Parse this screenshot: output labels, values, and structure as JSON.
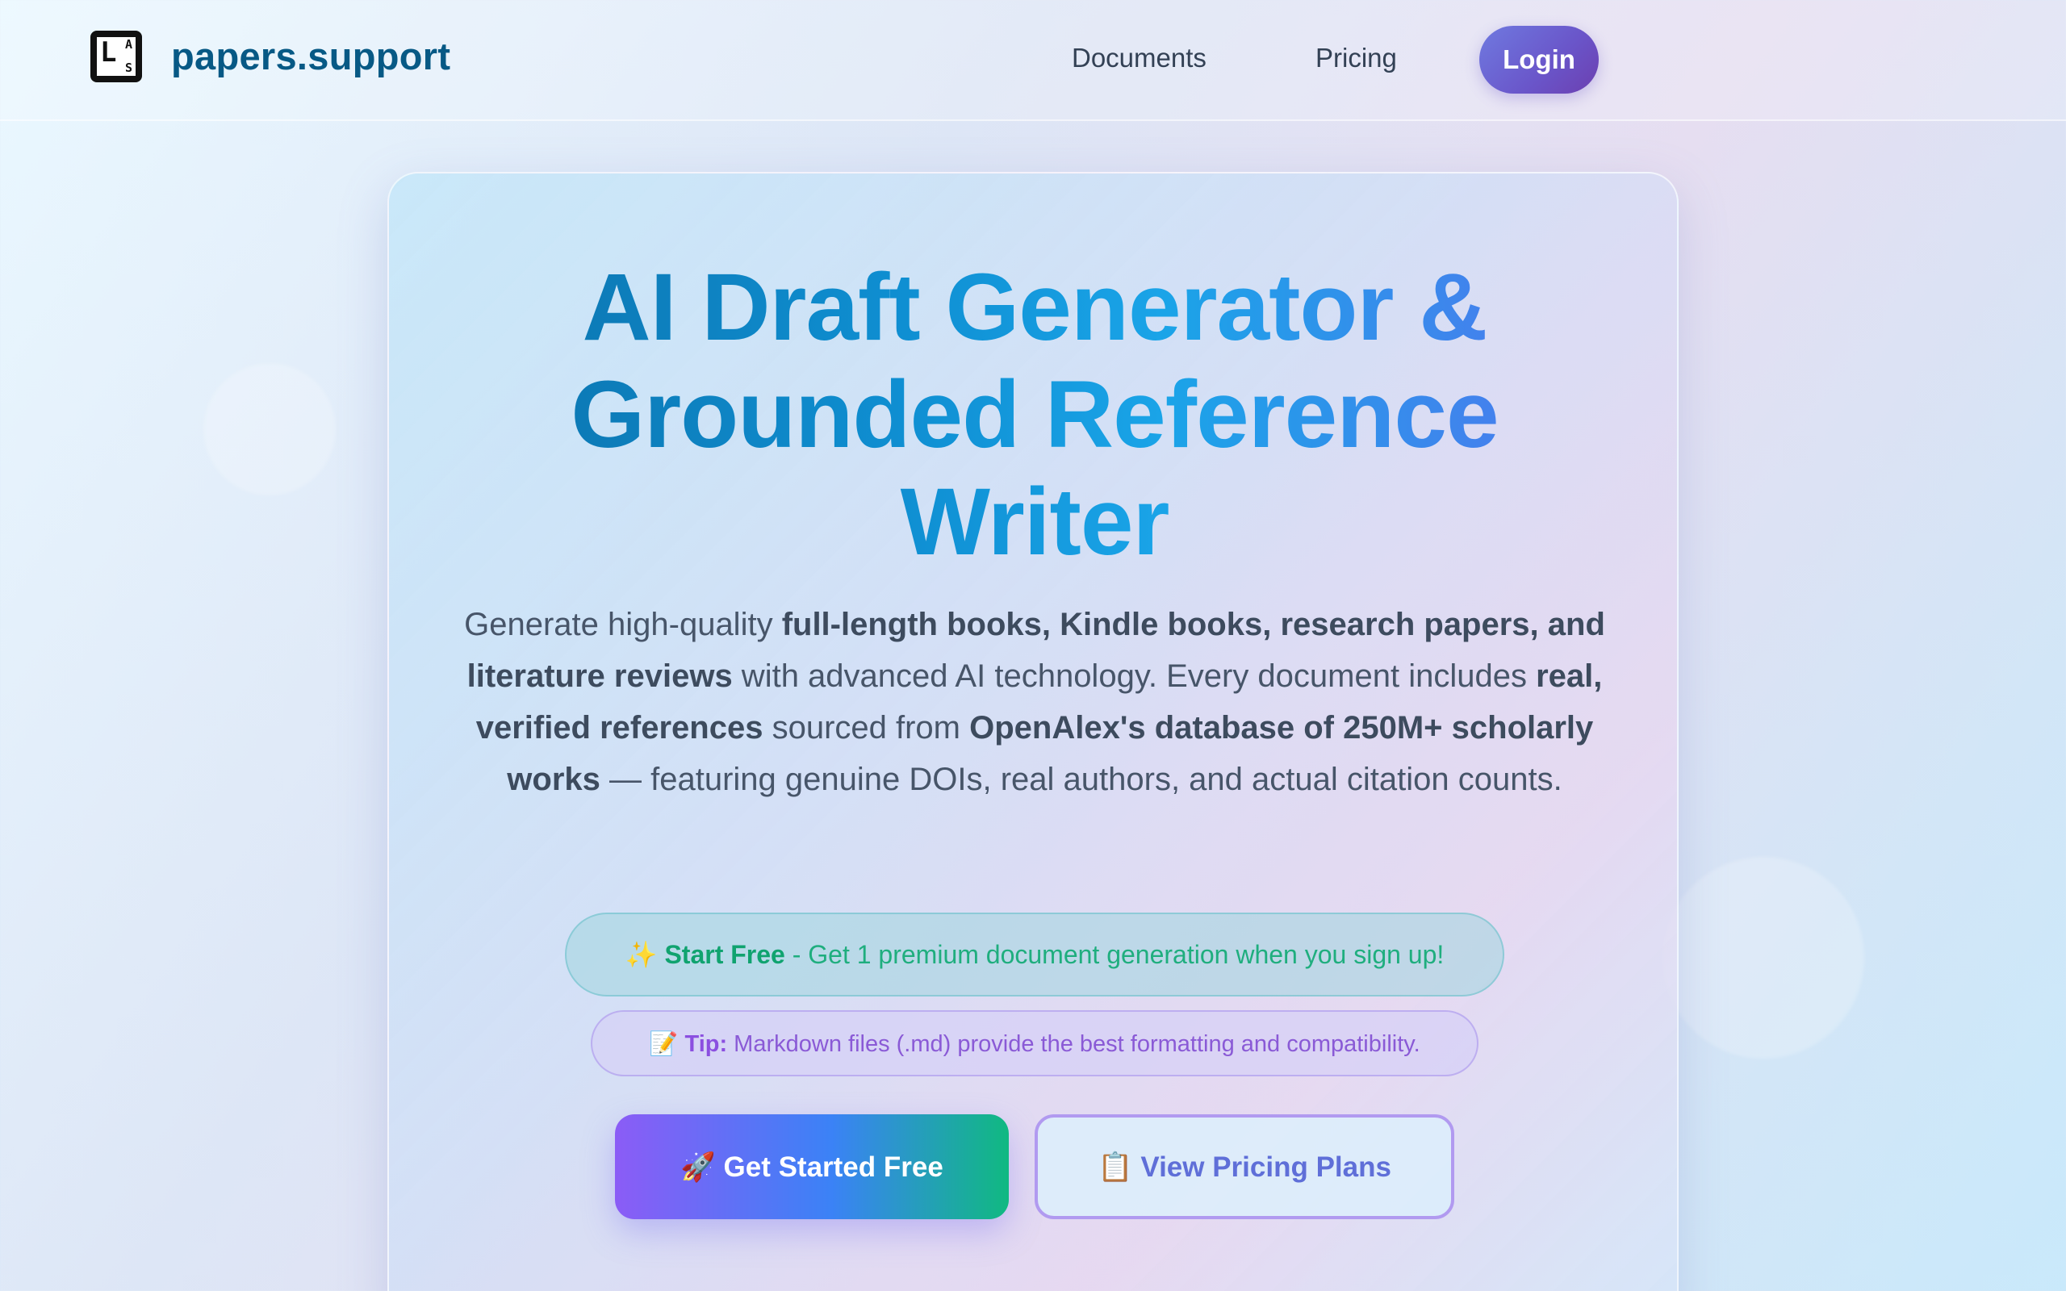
{
  "header": {
    "logo_letters": [
      "L",
      "A",
      "S"
    ],
    "brand": "papers.support",
    "nav": {
      "documents": "Documents",
      "pricing": "Pricing",
      "login": "Login"
    }
  },
  "hero": {
    "title_lines": [
      "AI Draft Generator &",
      "Grounded Reference",
      "Writer"
    ],
    "description": {
      "p1": "Generate high-quality ",
      "b1": "full-length books, Kindle books, research papers, and literature reviews",
      "p2": " with advanced AI technology. Every document includes ",
      "b2": "real, verified references",
      "p3": " sourced from ",
      "b3": "OpenAlex's database of 250M+ scholarly works",
      "p4": " — featuring genuine DOIs, real authors, and actual citation counts."
    },
    "promo": {
      "icon": "✨",
      "bold": "Start Free",
      "text": " - Get 1 premium document generation when you sign up!"
    },
    "tip": {
      "icon": "📝",
      "bold": "Tip:",
      "text": " Markdown files (.md) provide the best formatting and compatibility."
    },
    "cta_primary": {
      "icon": "🚀",
      "label": "Get Started Free"
    },
    "cta_secondary": {
      "icon": "📋",
      "label": "View Pricing Plans"
    }
  },
  "colors": {
    "brand": "#075985",
    "accent_green": "#10a36f",
    "accent_purple": "#8b4fe0"
  }
}
